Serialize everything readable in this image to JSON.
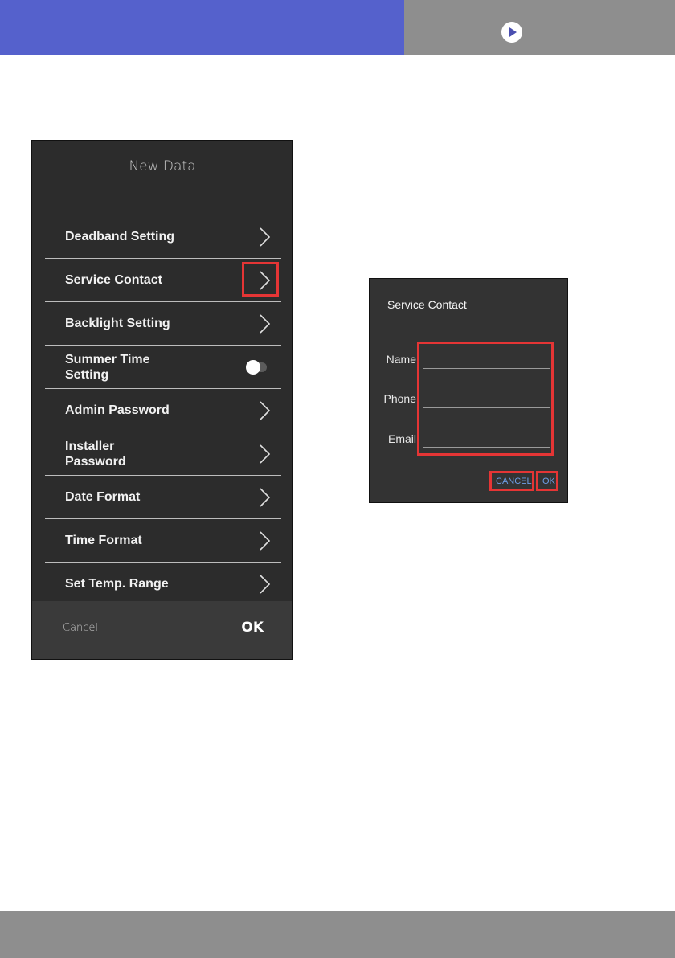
{
  "header": {
    "play_icon": "play-icon",
    "accent": "#5561cc",
    "bar_color": "#8e8e8e"
  },
  "panel": {
    "title": "New Data",
    "items": [
      {
        "label": "Deadband Setting",
        "control": "chevron"
      },
      {
        "label": "Service Contact",
        "control": "chevron"
      },
      {
        "label": "Backlight Setting",
        "control": "chevron"
      },
      {
        "label": "Summer Time\nSetting",
        "control": "toggle"
      },
      {
        "label": "Admin Password",
        "control": "chevron"
      },
      {
        "label": "Installer\nPassword",
        "control": "chevron"
      },
      {
        "label": "Date Format",
        "control": "chevron"
      },
      {
        "label": "Time Format",
        "control": "chevron"
      },
      {
        "label": "Set Temp. Range",
        "control": "chevron"
      }
    ],
    "cancel_label": "Cancel",
    "ok_label": "OK"
  },
  "dialog": {
    "title": "Service Contact",
    "fields": [
      {
        "label": "Name",
        "value": ""
      },
      {
        "label": "Phone",
        "value": ""
      },
      {
        "label": "Email",
        "value": ""
      }
    ],
    "cancel_label": "CANCEL",
    "ok_label": "OK"
  },
  "highlight_color": "#e53535"
}
